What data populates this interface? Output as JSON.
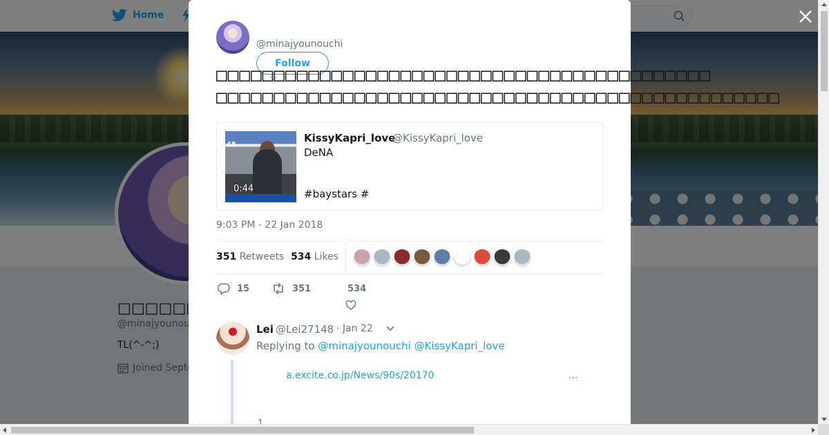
{
  "nav": {
    "home_label": "Home"
  },
  "profile": {
    "name": "□□□□□□□",
    "handle": "@minajyounouchi",
    "bio": "TL(^-^;)",
    "joined": "Joined Septe"
  },
  "tweet": {
    "author_handle": "@minajyounouchi",
    "follow_label": "Follow",
    "text_lines": [
      "□□□□□□□□□□□□□□□□□□□□□□□□□□□□□□□□□□□□□□□□□□□",
      "□□□□□□□□□□□□□□□□□□□□□□□□□□□□□□□□□□□□□□□□□□□□□□□□□"
    ],
    "quote": {
      "name": "KissyKapri_love",
      "handle": "@KissyKapri_love",
      "line1": "DeNA",
      "line2": "#baystars #",
      "video_duration": "0:44",
      "thumb_number": "45"
    },
    "timestamp": "9:03 PM - 22 Jan 2018",
    "retweets_count": "351",
    "retweets_label": "Retweets",
    "likes_count": "534",
    "likes_label": "Likes",
    "liker_colors": [
      "#c9a3a8",
      "#aab8c2",
      "#8a2b2b",
      "#7a5a3a",
      "#5c7fa8",
      "#ffffff",
      "#d94a3a",
      "#3a3a3a",
      "#aab8c2"
    ],
    "actions": {
      "reply_count": "15",
      "retweet_count": "351",
      "like_count": "534"
    }
  },
  "reply": {
    "name": "Lei",
    "handle": "@Lei27148",
    "date": "· Jan 22",
    "replying_prefix": "Replying to",
    "replying_to_1": "@minajyounouchi",
    "replying_to_2": "@KissyKapri_love",
    "link_text": "a.excite.co.jp/News/90s/20170",
    "more_text": "...",
    "partial_counts": "1"
  },
  "colors": {
    "accent": "#1da1f2",
    "muted": "#657786",
    "text": "#14171a"
  }
}
